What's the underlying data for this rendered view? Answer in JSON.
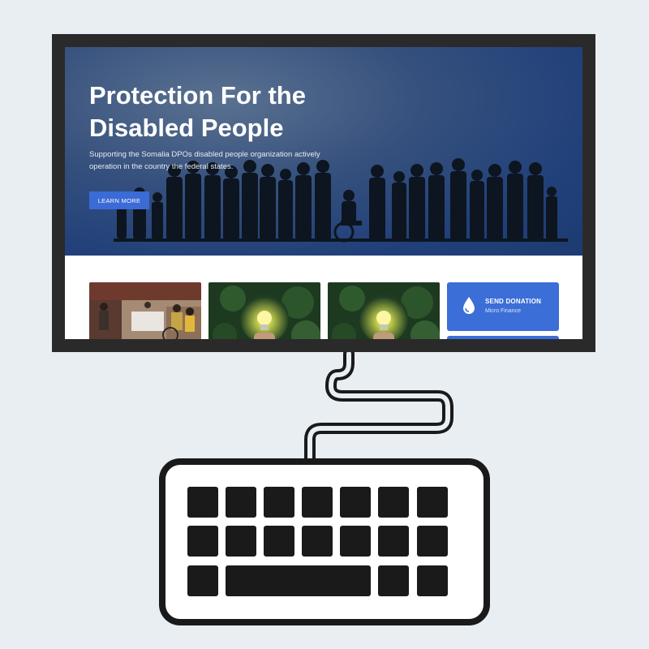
{
  "hero": {
    "title": "Protection For the Disabled People",
    "description": "Supporting the Somalia DPOs disabled people organization actively operation in the country the federal states.",
    "button_label": "LEARN MORE"
  },
  "cards": [
    {
      "kind": "photo",
      "subject": "event-photo"
    },
    {
      "kind": "photo",
      "subject": "lightbulb-photo"
    },
    {
      "kind": "photo",
      "subject": "lightbulb-photo"
    }
  ],
  "donation": {
    "title": "SEND DONATION",
    "subtitle": "Micro Finance",
    "icon": "water-drop-icon"
  },
  "colors": {
    "hero_bg": "#21407a",
    "accent": "#3a6bd6",
    "monitor_frame": "#2a2a2a",
    "background": "#e8eef2"
  }
}
